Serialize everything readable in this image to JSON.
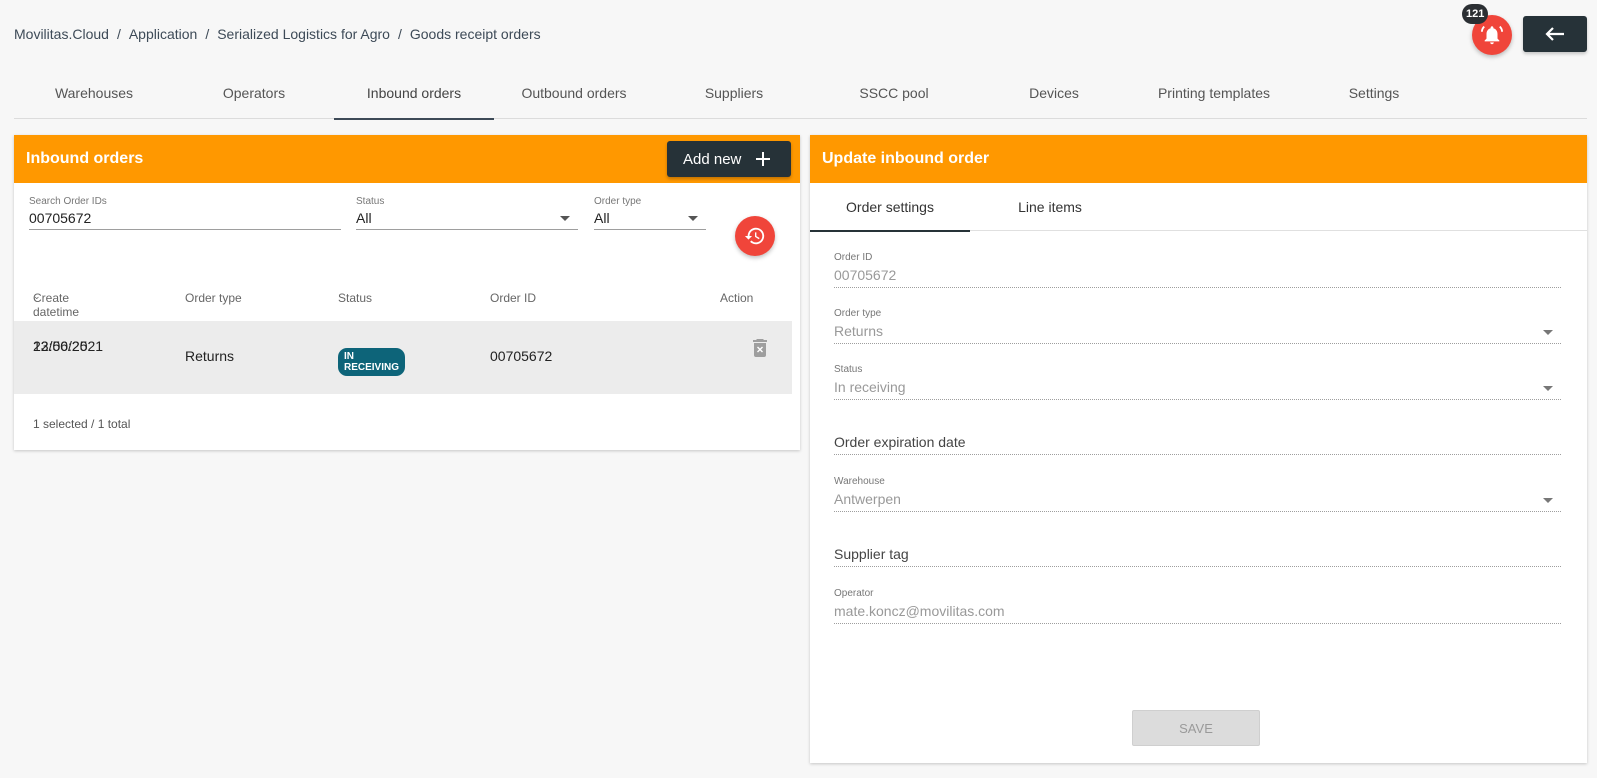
{
  "breadcrumb": [
    "Movilitas.Cloud",
    "Application",
    "Serialized Logistics for Agro",
    "Goods receipt orders"
  ],
  "breadcrumb_sep": "/",
  "notifications": {
    "count": "121",
    "color": "#f0453a"
  },
  "nav_tabs": [
    "Warehouses",
    "Operators",
    "Inbound orders",
    "Outbound orders",
    "Suppliers",
    "SSCC pool",
    "Devices",
    "Printing templates",
    "Settings"
  ],
  "left_panel": {
    "title": "Inbound orders",
    "add_label": "Add new",
    "search": {
      "label": "Search Order IDs",
      "value": "00705672"
    },
    "status_filter": {
      "label": "Status",
      "value": "All"
    },
    "type_filter": {
      "label": "Order type",
      "value": "All"
    },
    "columns": {
      "created": "Create datetime",
      "type": "Order type",
      "status": "Status",
      "order_id": "Order ID",
      "action": "Action"
    },
    "rows": [
      {
        "date": "22/06/2021",
        "time": "13:50:25",
        "type": "Returns",
        "status": "IN RECEIVING",
        "order_id": "00705672"
      }
    ],
    "footer": "1 selected / 1 total"
  },
  "right_panel": {
    "title": "Update inbound order",
    "tabs": [
      "Order settings",
      "Line items"
    ],
    "fields": {
      "order_id": {
        "label": "Order ID",
        "value": "00705672"
      },
      "order_type": {
        "label": "Order type",
        "value": "Returns"
      },
      "status": {
        "label": "Status",
        "value": "In receiving"
      },
      "expiration": {
        "label": "Order expiration date"
      },
      "warehouse": {
        "label": "Warehouse",
        "value": "Antwerpen"
      },
      "supplier": {
        "label": "Supplier tag"
      },
      "operator": {
        "label": "Operator",
        "value": "mate.koncz@movilitas.com"
      }
    },
    "save_label": "SAVE"
  },
  "colors": {
    "accent": "#ff9800",
    "dark": "#263238",
    "status_chip": "#0d6479"
  }
}
